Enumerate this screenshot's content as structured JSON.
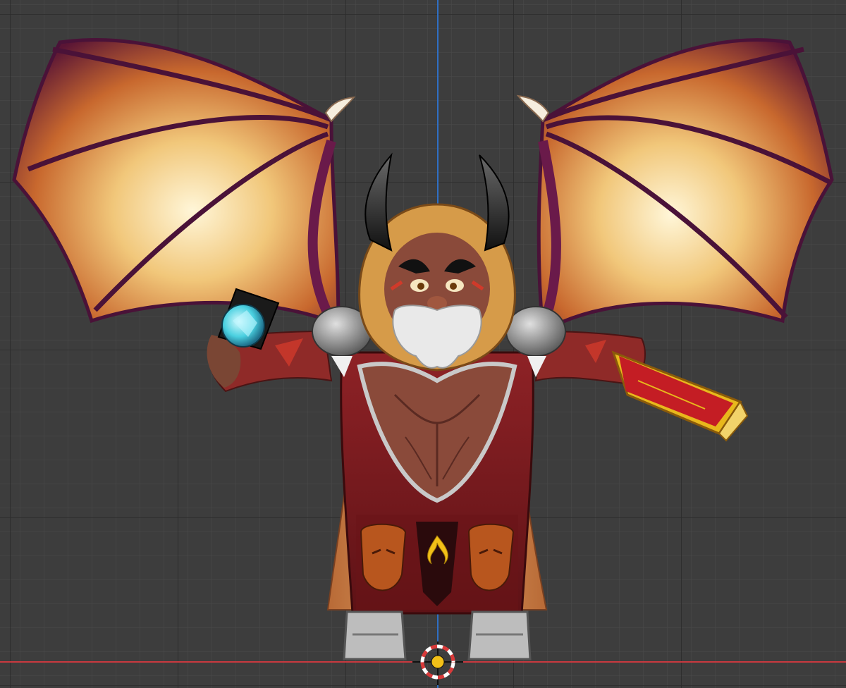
{
  "viewport": {
    "background_color": "#3d3d3d",
    "grid_minor_color": "#4a4a4a",
    "grid_major_color": "#2b2b2b",
    "axis_vertical_color": "#2f6fc4",
    "axis_horizontal_color": "#c9393f"
  },
  "cursor_3d": {
    "icon": "3d-cursor-icon",
    "ring_red": "#d93a3a",
    "ring_white": "#ffffff",
    "center_color": "#f2c018"
  },
  "model": {
    "name": "winged-demon-dwarf-character",
    "wing_membrane_color": "#e8a24a",
    "wing_bone_color": "#4a1238",
    "hood_color": "#d69b49",
    "robe_color": "#7a1a1e",
    "cape_color": "#cf8449",
    "skin_color": "#8a4a3a",
    "beard_color": "#e9e9e9",
    "armor_color": "#bdbdbd",
    "orb_color": "#4ad0e0",
    "book_color": "#c41d24",
    "book_trim_color": "#e8b81c"
  }
}
